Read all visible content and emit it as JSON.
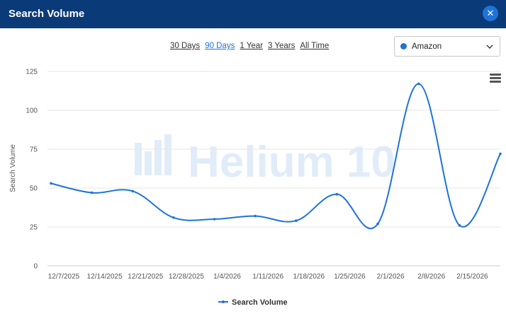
{
  "header": {
    "title": "Search Volume",
    "close_icon": "close-icon",
    "close_symbol": "✕",
    "bg_color": "#0b3a78"
  },
  "ranges": [
    {
      "label": "30 Days",
      "active": false
    },
    {
      "label": "90 Days",
      "active": true
    },
    {
      "label": "1 Year",
      "active": false
    },
    {
      "label": "3 Years",
      "active": false
    },
    {
      "label": "All Time",
      "active": false
    }
  ],
  "marketplace": {
    "selected": "Amazon",
    "dot_color": "#1e73d9"
  },
  "watermark": "Helium 10",
  "chart_data": {
    "type": "line",
    "ylabel": "Search Volume",
    "xlabel": "",
    "ylim": [
      0,
      125
    ],
    "yticks": [
      0,
      25,
      50,
      75,
      100,
      125
    ],
    "categories": [
      "12/7/2025",
      "12/14/2025",
      "12/21/2025",
      "12/28/2025",
      "1/4/2026",
      "1/11/2026",
      "1/18/2026",
      "1/25/2026",
      "2/1/2026",
      "2/8/2026",
      "2/15/2026",
      ""
    ],
    "series": [
      {
        "name": "Search Volume",
        "color": "#1e73d9",
        "values": [
          53,
          47,
          48,
          31,
          30,
          32,
          29,
          46,
          27,
          117,
          26,
          72
        ]
      }
    ],
    "legend": "bottom-center",
    "grid": true
  }
}
